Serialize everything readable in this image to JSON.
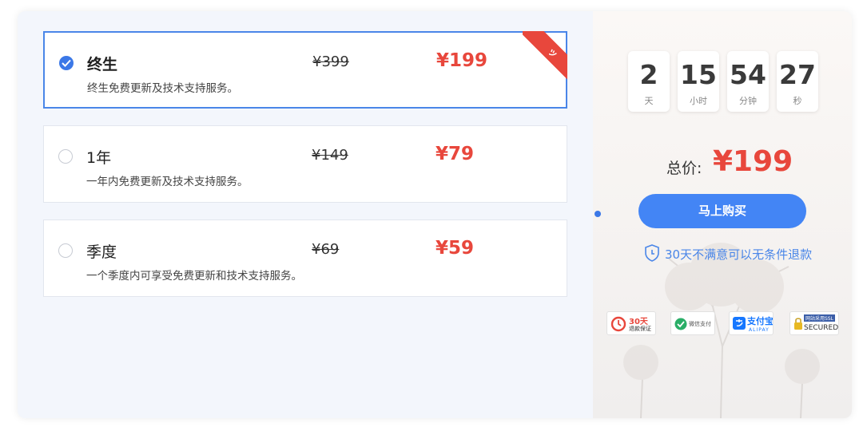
{
  "plans": [
    {
      "name": "终生",
      "description": "终生免费更新及技术支持服务。",
      "original_price": "¥399",
      "price": "¥199",
      "selected": true,
      "ribbon": "ッ"
    },
    {
      "name": "1年",
      "description": "一年内免费更新及技术支持服务。",
      "original_price": "¥149",
      "price": "¥79",
      "selected": false
    },
    {
      "name": "季度",
      "description": "一个季度内可享受免费更新和技术支持服务。",
      "original_price": "¥69",
      "price": "¥59",
      "selected": false
    }
  ],
  "countdown": [
    {
      "value": "2",
      "unit": "天"
    },
    {
      "value": "15",
      "unit": "小时"
    },
    {
      "value": "54",
      "unit": "分钟"
    },
    {
      "value": "27",
      "unit": "秒"
    }
  ],
  "total": {
    "label": "总价:",
    "price": "¥199"
  },
  "buy_button": "马上购买",
  "guarantee": "30天不满意可以无条件退款",
  "badges": {
    "refund": {
      "title": "30天",
      "subtitle": "退款保证"
    },
    "wechat": {
      "label": "微信支付"
    },
    "alipay": {
      "label": "支付宝",
      "sub": "ALIPAY"
    },
    "ssl": {
      "title": "网站采用SSL",
      "label": "SECURED"
    }
  },
  "colors": {
    "accent": "#4385f5",
    "price_red": "#e8473c",
    "selected_border": "#4a86e8"
  }
}
